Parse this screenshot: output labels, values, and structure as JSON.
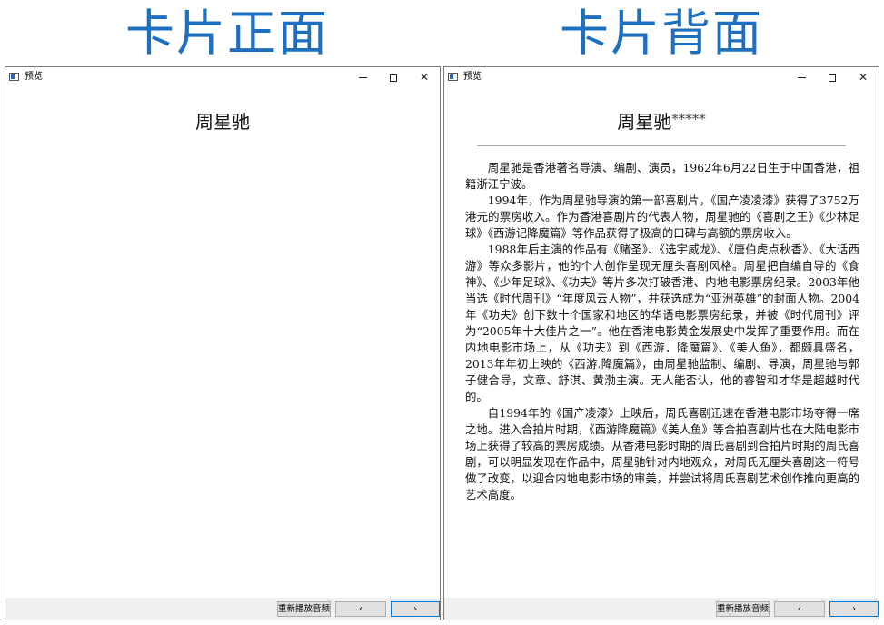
{
  "headings": {
    "front": "卡片正面",
    "back": "卡片背面"
  },
  "front_window": {
    "title": "预览",
    "controls": {
      "minimize": "–",
      "close": "✕"
    },
    "card_name": "周星驰",
    "buttons": {
      "replay": "重新播放音频",
      "prev": "‹",
      "next": "›"
    }
  },
  "back_window": {
    "title": "预览",
    "controls": {
      "minimize": "–",
      "close": "✕"
    },
    "card_name": "周星驰",
    "stars": "*****",
    "bio": [
      "周星驰是香港著名导演、编剧、演员，1962年6月22日生于中国香港，祖籍浙江宁波。",
      "1994年，作为周星驰导演的第一部喜剧片，《国产凌凌漆》获得了3752万港元的票房收入。作为香港喜剧片的代表人物，周星驰的《喜剧之王》《少林足球》《西游记降魔篇》等作品获得了极高的口碑与高额的票房收入。",
      "1988年后主演的作品有《赌圣》、《选宇威龙》、《唐伯虎点秋香》、《大话西游》等众多影片，他的个人创作呈现无厘头喜剧风格。周星把自编自导的《食神》、《少年足球》、《功夫》等片多次打破香港、内地电影票房纪录。2003年他当选《时代周刊》“年度风云人物”，并获选成为“亚洲英雄”的封面人物。2004年《功夫》创下数十个国家和地区的华语电影票房纪录，并被《时代周刊》评为“2005年十大佳片之一”。他在香港电影黄金发展史中发挥了重要作用。而在内地电影市场上，从《功夫》到《西游．降魔篇》、《美人鱼》，都颇具盛名，2013年年初上映的《西游.降魔篇》，由周星驰监制、编剧、导演，周星驰与郭子健合导，文章、舒淇、黄渤主演。无人能否认，他的睿智和才华是超越时代的。",
      "自1994年的《国产凌漆》上映后，周氏喜剧迅速在香港电影市场夺得一席之地。进入合拍片时期，《西游降魔篇》《美人鱼》等合拍喜剧片也在大陆电影市场上获得了较高的票房成绩。从香港电影时期的周氏喜剧到合拍片时期的周氏喜剧，可以明显发现在作品中，周星驰针对内地观众，对周氏无厘头喜剧这一符号做了改变，以迎合内地电影市场的审美，并尝试将周氏喜剧艺术创作推向更高的艺术高度。"
    ],
    "buttons": {
      "replay": "重新播放音频",
      "prev": "‹",
      "next": "›"
    }
  },
  "colors": {
    "heading": "#1f6fc0",
    "next_button_border": "#0078d7"
  }
}
